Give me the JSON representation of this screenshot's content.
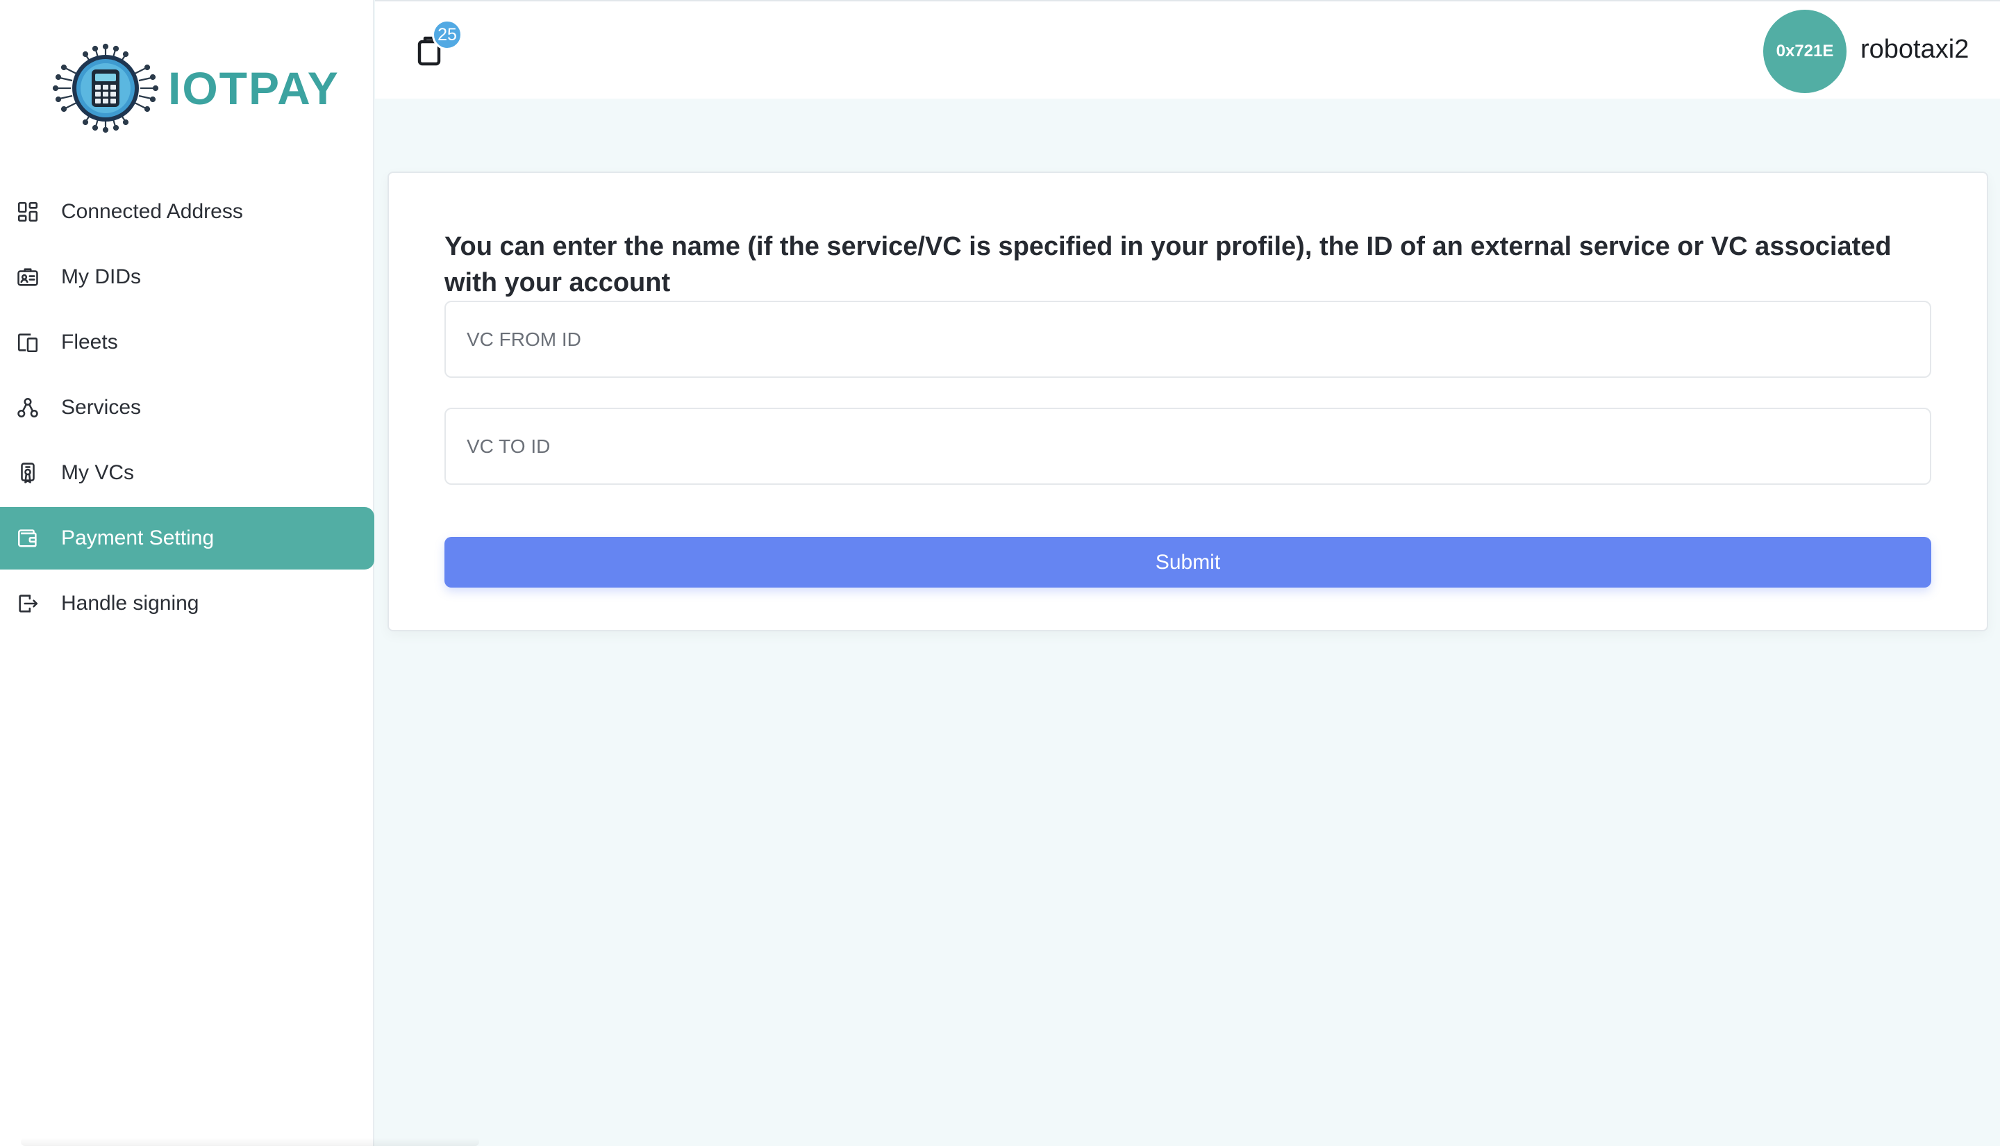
{
  "brand": {
    "name": "IOTPAY",
    "accent": "#52aea4",
    "logo_icon": "calculator-chip-icon"
  },
  "sidebar": {
    "items": [
      {
        "label": "Connected Address",
        "icon": "dashboard-grid-icon",
        "active": false
      },
      {
        "label": "My DIDs",
        "icon": "id-card-icon",
        "active": false
      },
      {
        "label": "Fleets",
        "icon": "devices-icon",
        "active": false
      },
      {
        "label": "Services",
        "icon": "network-nodes-icon",
        "active": false
      },
      {
        "label": "My VCs",
        "icon": "credential-icon",
        "active": false
      },
      {
        "label": "Payment Setting",
        "icon": "wallet-icon",
        "active": true
      },
      {
        "label": "Handle signing",
        "icon": "sign-in-icon",
        "active": false
      }
    ]
  },
  "header": {
    "notification_count": "25",
    "notification_icon": "clipboard-icon",
    "avatar_text": "0x721E",
    "username": "robotaxi2"
  },
  "form": {
    "description": "You can enter the name (if the service/VC is specified in your profile), the ID of an external service or VC associated with your account",
    "from_placeholder": "VC FROM ID",
    "from_value": "",
    "to_placeholder": "VC TO ID",
    "to_value": "",
    "submit_label": "Submit",
    "submit_color": "#6585f2"
  }
}
